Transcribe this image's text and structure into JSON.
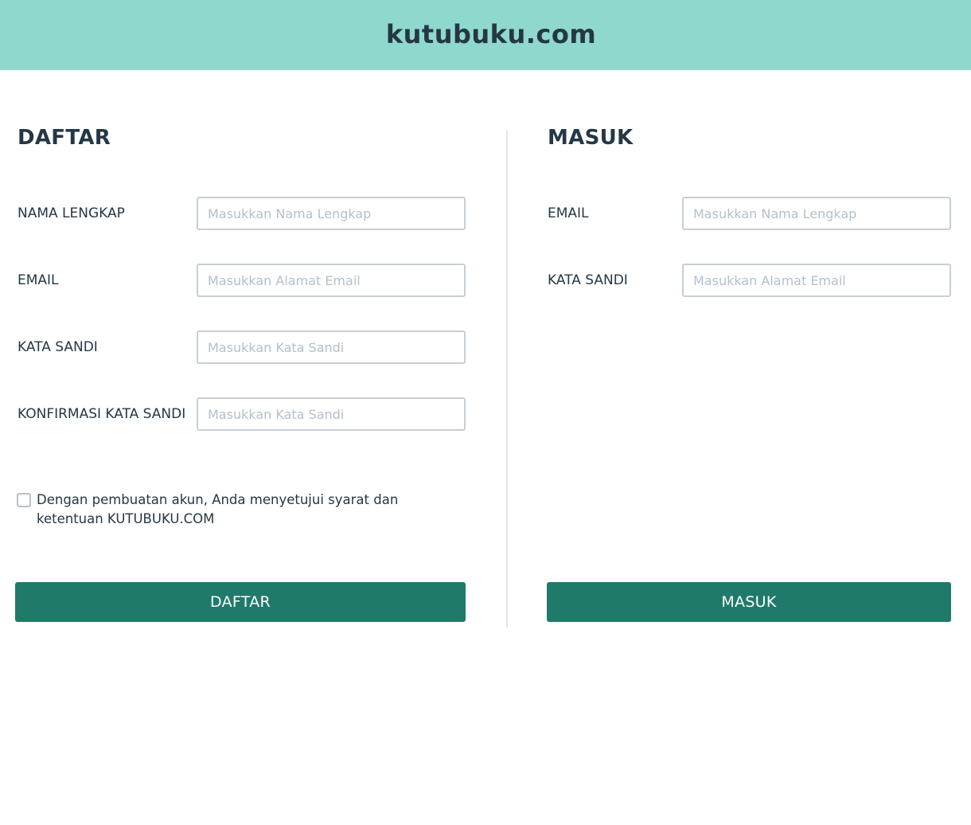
{
  "header": {
    "site_title": "kutubuku.com"
  },
  "register": {
    "title": "DAFTAR",
    "fields": [
      {
        "label": "NAMA LENGKAP",
        "placeholder": "Masukkan Nama Lengkap",
        "value": ""
      },
      {
        "label": "EMAIL",
        "placeholder": "Masukkan Alamat Email",
        "value": ""
      },
      {
        "label": "KATA SANDI",
        "placeholder": "Masukkan Kata Sandi",
        "value": ""
      },
      {
        "label": "KONFIRMASI KATA SANDI",
        "placeholder": "Masukkan Kata Sandi",
        "value": ""
      }
    ],
    "terms": {
      "checked": false,
      "text": "Dengan pembuatan akun, Anda menyetujui syarat dan ketentuan KUTUBUKU.COM"
    },
    "submit_label": "DAFTAR"
  },
  "login": {
    "title": "MASUK",
    "fields": [
      {
        "label": "EMAIL",
        "placeholder": "Masukkan Nama Lengkap",
        "value": ""
      },
      {
        "label": "KATA SANDI",
        "placeholder": "Masukkan Alamat Email",
        "value": ""
      }
    ],
    "submit_label": "MASUK"
  },
  "colors": {
    "header_bg": "#8fd8cd",
    "text_primary": "#253746",
    "button_bg": "#207a6a",
    "input_border": "#c6cfd6",
    "placeholder": "#b4c0cb"
  }
}
